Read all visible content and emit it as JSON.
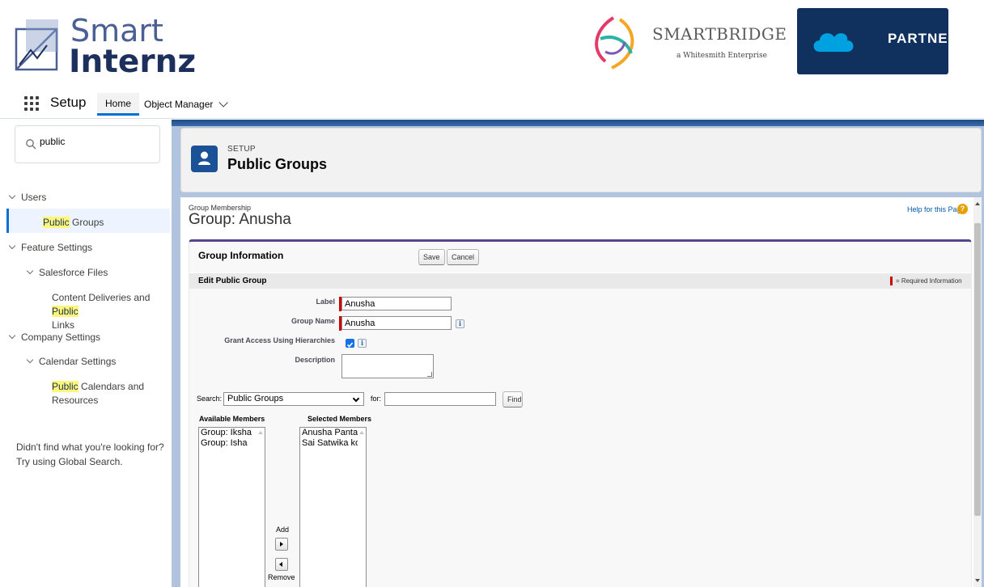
{
  "brand": {
    "logo_line1": "Smart",
    "logo_line2": "Internz",
    "partner_logo_title": "SMARTBRIDGE",
    "partner_logo_subtitle": "a Whitesmith Enterprise",
    "partner_badge": "PARTNER"
  },
  "nav": {
    "app_name": "Setup",
    "tabs": [
      {
        "label": "Home",
        "active": true
      },
      {
        "label": "Object Manager",
        "has_dropdown": true
      }
    ]
  },
  "sidebar": {
    "quick_find_value": "public",
    "highlight_color": "#fff67a",
    "tree": {
      "users": "Users",
      "public_groups_hl": "Public",
      "public_groups_rest": " Groups",
      "feature_settings": "Feature Settings",
      "salesforce_files": "Salesforce Files",
      "content_deliveries_a": "Content Deliveries and ",
      "content_deliveries_hl": "Public",
      "content_deliveries_b": "Links",
      "company_settings": "Company Settings",
      "calendar_settings": "Calendar Settings",
      "public_calendars_hl": "Public",
      "public_calendars_a": " Calendars and",
      "public_calendars_b": "Resources"
    },
    "not_found_line1": "Didn't find what you're looking for?",
    "not_found_line2": "Try using Global Search."
  },
  "page_header": {
    "kicker": "SETUP",
    "title": "Public Groups",
    "icon_color": "#1b5297"
  },
  "group_page": {
    "kicker": "Group Membership",
    "title": "Group: Anusha",
    "help_link": "Help for this Page",
    "block_title": "Group Information",
    "save_label": "Save",
    "cancel_label": "Cancel",
    "section_title": "Edit Public Group",
    "required_info": "= Required Information",
    "fields": {
      "label_caption": "Label",
      "label_value": "Anusha",
      "group_name_caption": "Group Name",
      "group_name_value": "Anusha",
      "grant_access_caption": "Grant Access Using Hierarchies",
      "grant_access_checked": true,
      "description_caption": "Description",
      "description_value": ""
    },
    "search": {
      "label": "Search:",
      "selected": "Public Groups",
      "for_label": "for:",
      "for_value": "",
      "find_label": "Find"
    },
    "available_members_label": "Available Members",
    "selected_members_label": "Selected Members",
    "available_members": [
      "Group: Iksha",
      "Group: Isha"
    ],
    "selected_members": [
      "Anusha Pantala",
      "Sai Satwika kolli"
    ],
    "add_label": "Add",
    "remove_label": "Remove"
  }
}
